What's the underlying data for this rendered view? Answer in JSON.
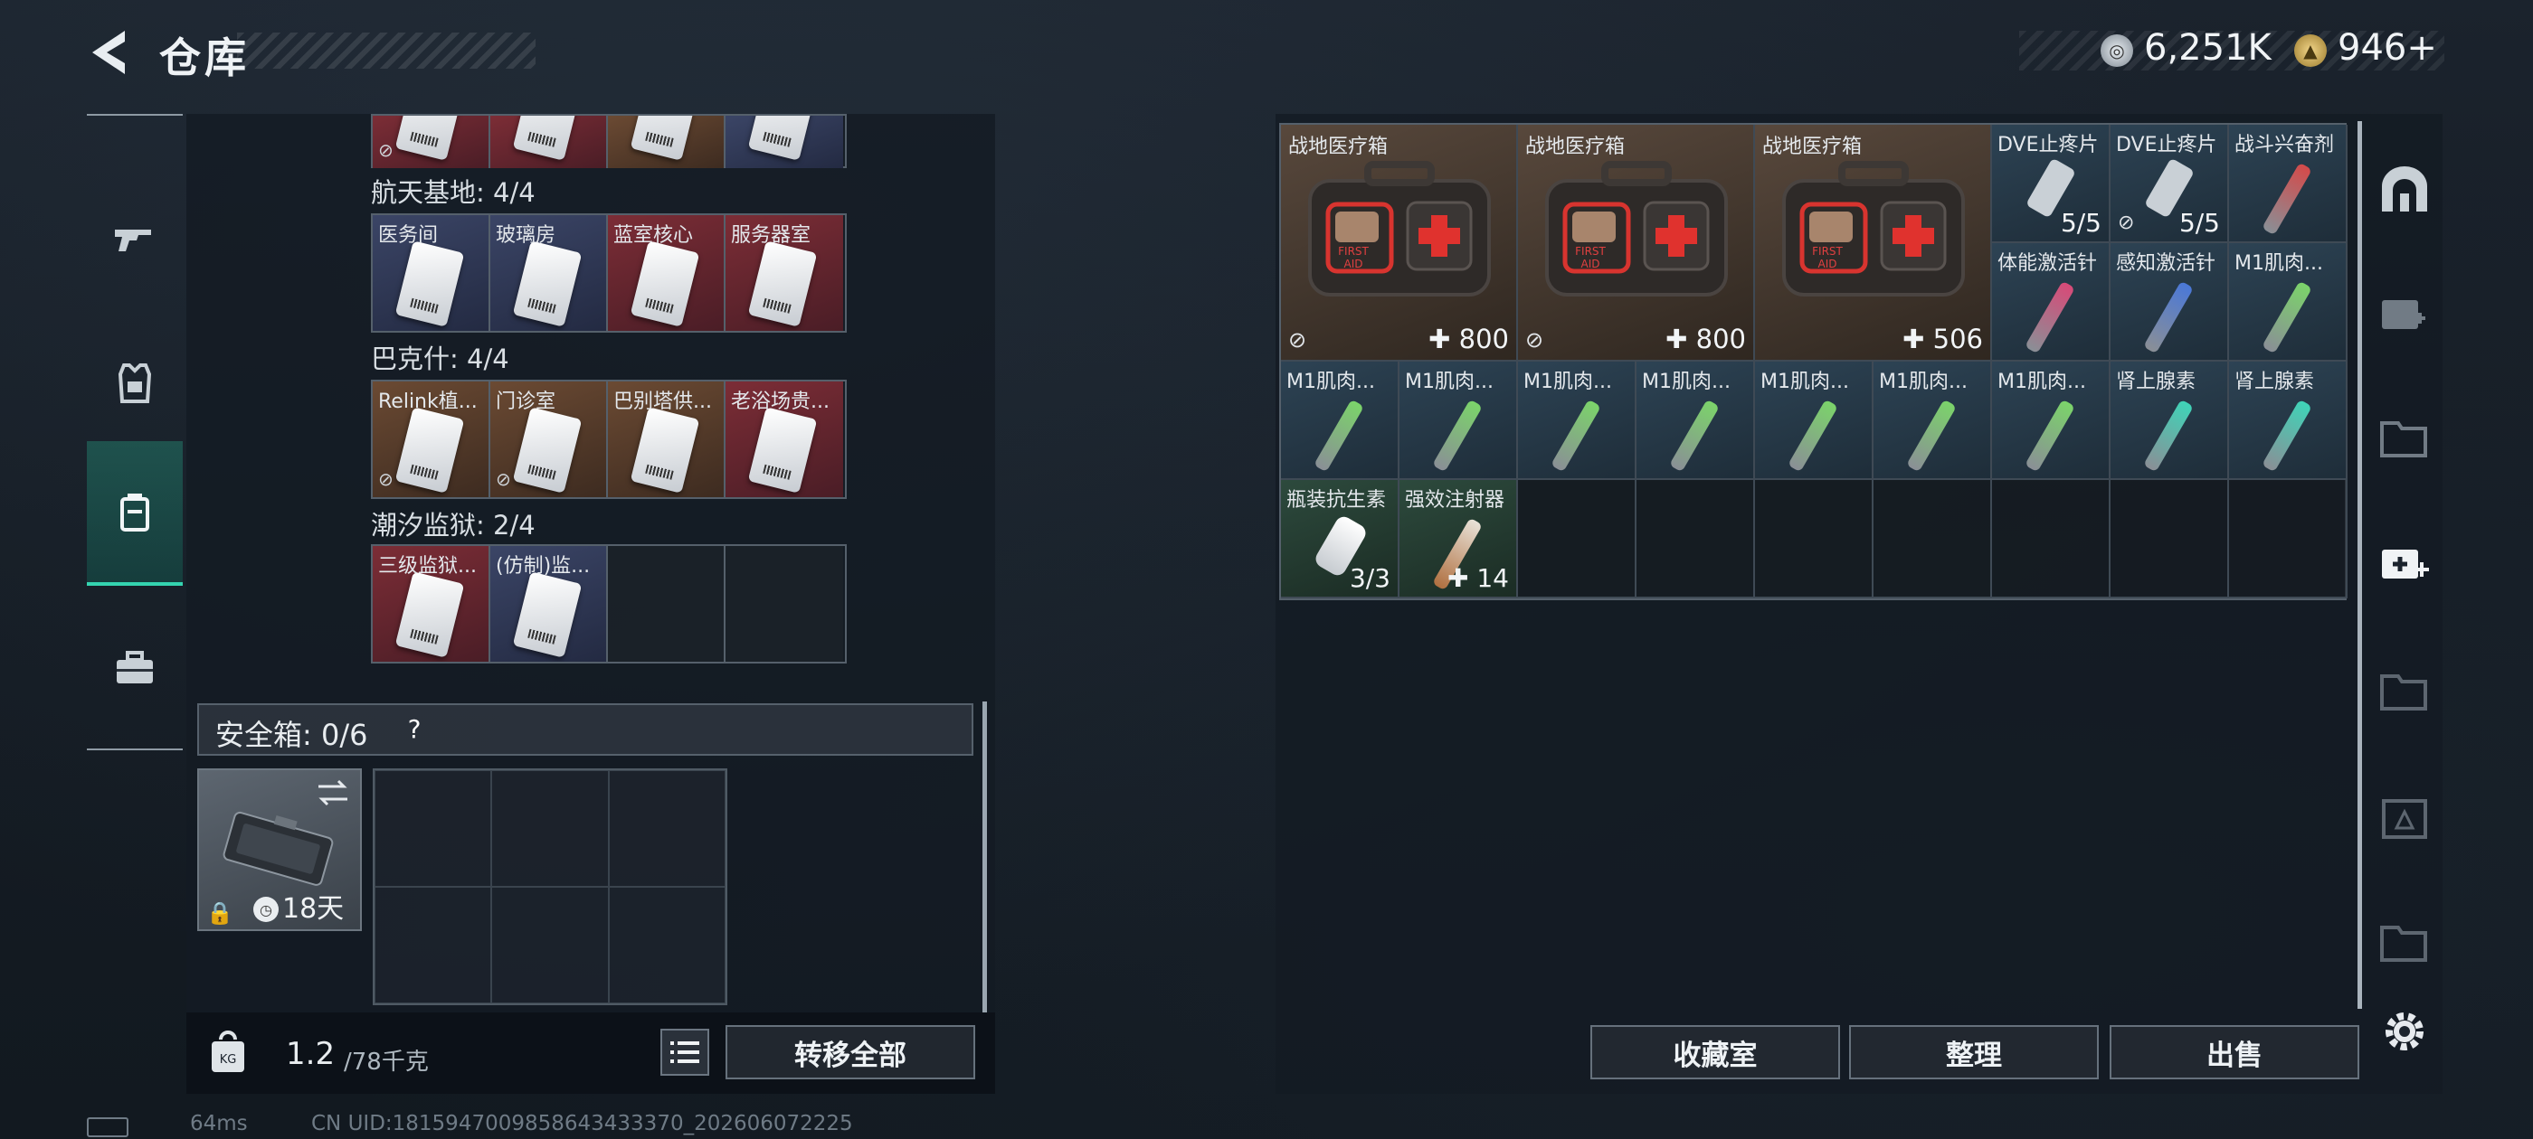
{
  "header": {
    "title": "仓库",
    "currency1": "6,251K",
    "currency2": "946+"
  },
  "left_groups": [
    {
      "title": "航天基地: 4/4",
      "items": [
        {
          "name": "医务间",
          "bg": "blue"
        },
        {
          "name": "玻璃房",
          "bg": "blue"
        },
        {
          "name": "蓝室核心",
          "bg": "red"
        },
        {
          "name": "服务器室",
          "bg": "red"
        }
      ]
    },
    {
      "title": "巴克什: 4/4",
      "items": [
        {
          "name": "Relink植...",
          "bg": "brown"
        },
        {
          "name": "门诊室",
          "bg": "brown"
        },
        {
          "name": "巴别塔供...",
          "bg": "brown"
        },
        {
          "name": "老浴场贵...",
          "bg": "red"
        }
      ]
    },
    {
      "title": "潮汐监狱: 2/4",
      "items": [
        {
          "name": "三级监狱...",
          "bg": "red"
        },
        {
          "name": "(仿制)监...",
          "bg": "blue"
        },
        {
          "name": "",
          "bg": "empty"
        },
        {
          "name": "",
          "bg": "empty"
        }
      ]
    }
  ],
  "safe": {
    "label": "安全箱: 0/6",
    "help": "?",
    "days": "18天"
  },
  "weight": {
    "value": "1.2",
    "capacity": "/78千克"
  },
  "buttons": {
    "transfer_all": "转移全部",
    "collection": "收藏室",
    "organize": "整理",
    "sell": "出售"
  },
  "status": {
    "ping": "64ms",
    "uid": "CN UID:1815947009858643433370_202606072225"
  },
  "right_items": {
    "kits": [
      {
        "name": "战地医疗箱",
        "count": "800"
      },
      {
        "name": "战地医疗箱",
        "count": "800"
      },
      {
        "name": "战地医疗箱",
        "count": "506"
      }
    ],
    "row1": [
      {
        "name": "DVE止疼片",
        "count": "5/5",
        "color": "#c9d0d6"
      },
      {
        "name": "DVE止疼片",
        "count": "5/5",
        "color": "#c9d0d6"
      },
      {
        "name": "战斗兴奋剂",
        "count": "",
        "color": "#d44a4a"
      }
    ],
    "row2": [
      {
        "name": "体能激活针",
        "count": "",
        "color": "#d84a78"
      },
      {
        "name": "感知激活针",
        "count": "",
        "color": "#4a78d8"
      },
      {
        "name": "M1肌肉...",
        "count": "",
        "color": "#7bd46a"
      }
    ],
    "row3": [
      {
        "name": "M1肌肉...",
        "color": "#7bd46a"
      },
      {
        "name": "M1肌肉...",
        "color": "#7bd46a"
      },
      {
        "name": "M1肌肉...",
        "color": "#7bd46a"
      },
      {
        "name": "M1肌肉...",
        "color": "#7bd46a"
      },
      {
        "name": "M1肌肉...",
        "color": "#7bd46a"
      },
      {
        "name": "M1肌肉...",
        "color": "#7bd46a"
      },
      {
        "name": "M1肌肉...",
        "color": "#7bd46a"
      },
      {
        "name": "肾上腺素",
        "color": "#3fd4b8"
      },
      {
        "name": "肾上腺素",
        "color": "#3fd4b8"
      }
    ],
    "row4": [
      {
        "name": "瓶装抗生素",
        "count": "3/3"
      },
      {
        "name": "强效注射器",
        "count": "14"
      }
    ]
  }
}
